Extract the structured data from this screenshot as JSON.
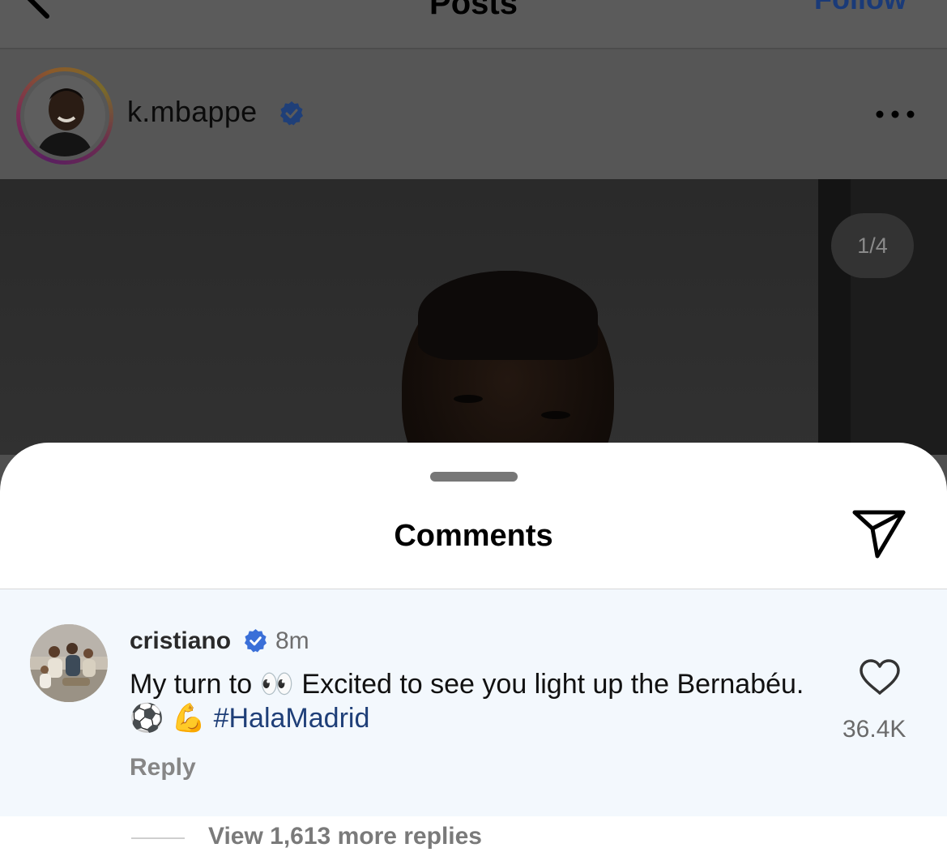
{
  "topbar": {
    "title": "Posts",
    "follow_label": "Follow"
  },
  "post": {
    "username": "k.mbappe",
    "image_counter": "1/4"
  },
  "comments_sheet": {
    "title": "Comments",
    "comment": {
      "username": "cristiano",
      "time": "8m",
      "text_part1": "My turn to ",
      "emoji_eyes": "👀",
      "text_part2": " Excited to see you light up the Bernabéu. ",
      "emoji_ball": "⚽",
      "emoji_muscle": "💪",
      "hashtag": "#HalaMadrid",
      "reply_label": "Reply",
      "like_count": "36.4K"
    },
    "view_replies_label": "View 1,613 more replies"
  },
  "colors": {
    "verified_badge": "#3a6fd8",
    "hashtag": "#1f3f78",
    "sheet_background": "#ffffff",
    "comment_highlight": "#f3f8fd"
  },
  "icons": [
    "back-arrow-icon",
    "verified-icon",
    "more-icon",
    "share-icon",
    "heart-icon"
  ]
}
